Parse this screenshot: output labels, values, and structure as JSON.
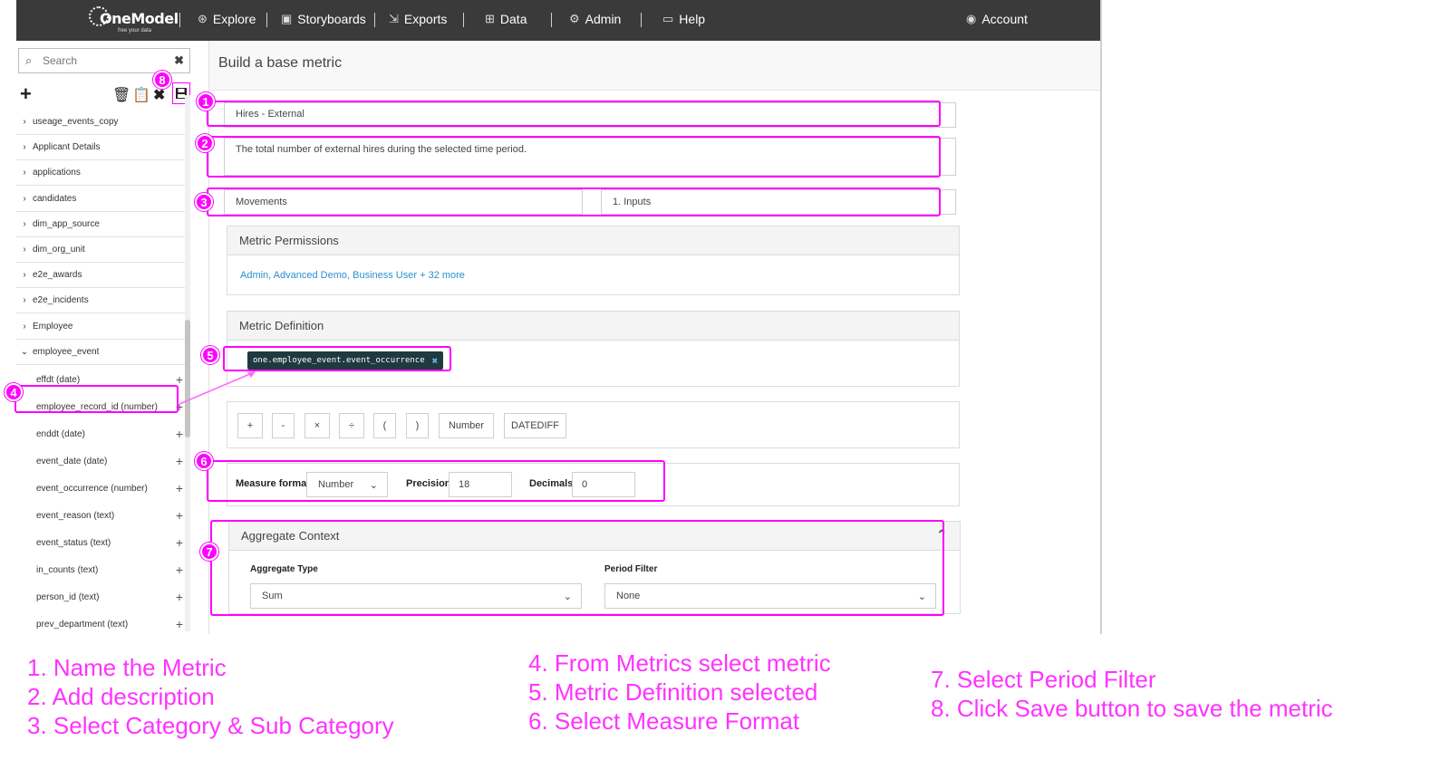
{
  "nav": {
    "logo": "OneModel",
    "tagline": "free your data",
    "items": [
      {
        "label": "Explore",
        "icon": "compass-icon"
      },
      {
        "label": "Storyboards",
        "icon": "storyboard-icon"
      },
      {
        "label": "Exports",
        "icon": "export-icon"
      },
      {
        "label": "Data",
        "icon": "data-icon"
      },
      {
        "label": "Admin",
        "icon": "gear-icon"
      },
      {
        "label": "Help",
        "icon": "help-icon"
      }
    ],
    "account": "Account"
  },
  "sidebar": {
    "search_placeholder": "Search",
    "tree": [
      "useage_events_copy",
      "Applicant Details",
      "applications",
      "candidates",
      "dim_app_source",
      "dim_org_unit",
      "e2e_awards",
      "e2e_incidents",
      "Employee",
      "employee_event"
    ],
    "children": [
      "effdt (date)",
      "employee_record_id (number)",
      "enddt (date)",
      "event_date (date)",
      "event_occurrence (number)",
      "event_reason (text)",
      "event_status (text)",
      "in_counts (text)",
      "person_id (text)",
      "prev_department (text)"
    ]
  },
  "main": {
    "title": "Build a base metric",
    "name_value": "Hires - External",
    "description_value": "The total number of external hires during the selected time period.",
    "category": "Movements",
    "subcategory": "1. Inputs",
    "permissions_title": "Metric Permissions",
    "permissions_link": "Admin, Advanced Demo, Business User + 32 more",
    "definition_title": "Metric Definition",
    "definition_chip": "one.employee_event.event_occurrence",
    "operators": [
      "+",
      "-",
      "×",
      "÷",
      "(",
      ")",
      "Number",
      "DATEDIFF"
    ],
    "measure_format_label": "Measure format",
    "measure_format_value": "Number",
    "precision_label": "Precision",
    "precision_value": "18",
    "decimals_label": "Decimals",
    "decimals_value": "0",
    "aggregate_title": "Aggregate Context",
    "aggregate_type_label": "Aggregate Type",
    "aggregate_type_value": "Sum",
    "period_filter_label": "Period Filter",
    "period_filter_value": "None"
  },
  "annotations": {
    "markers": [
      "1",
      "2",
      "3",
      "4",
      "5",
      "6",
      "7",
      "8"
    ],
    "steps": [
      "1. Name the Metric",
      "2. Add description",
      "3. Select Category & Sub Category",
      "4. From Metrics select metric",
      "5. Metric Definition selected",
      "6. Select Measure Format",
      "7. Select Period Filter",
      "8. Click Save button to save the metric"
    ],
    "highlight_color": "#ff00ff"
  }
}
